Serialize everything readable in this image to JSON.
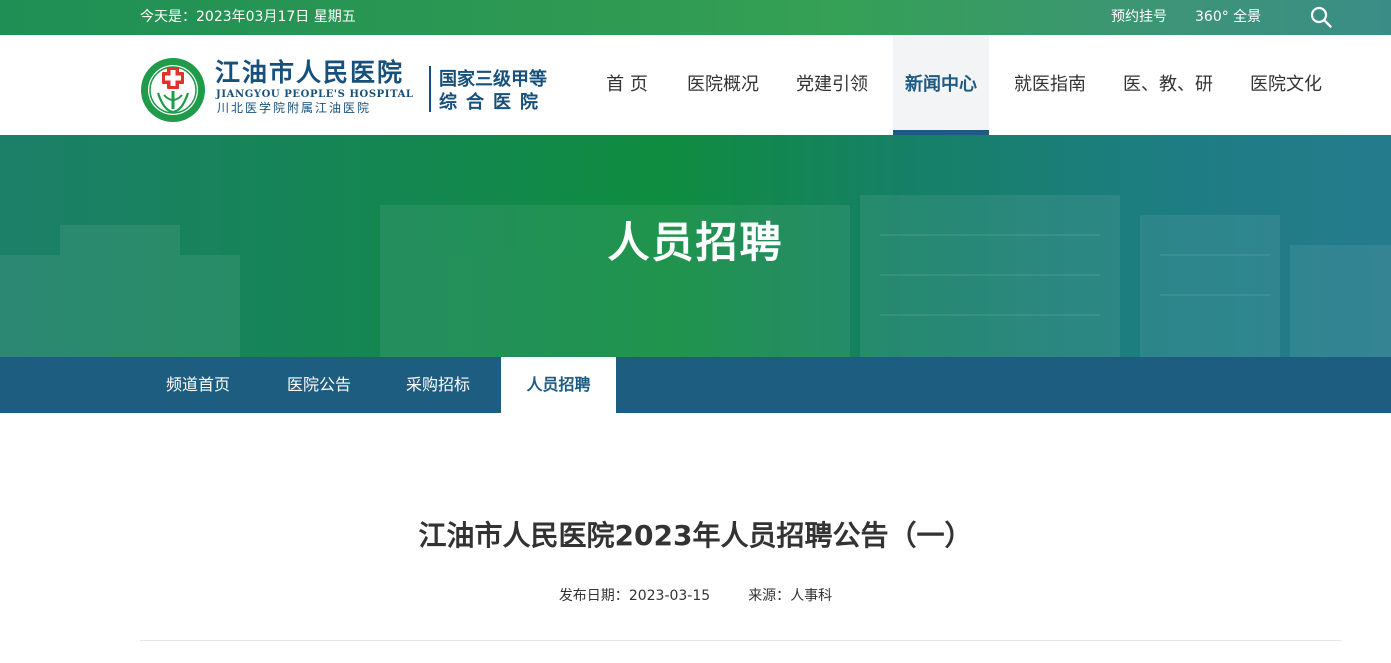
{
  "topbar": {
    "date_text": "今天是：2023年03月17日 星期五",
    "appointment_label": "预约挂号",
    "panorama_label": "360° 全景",
    "search_icon": "search-icon"
  },
  "logo": {
    "cn_name": "江油市人民医院",
    "en_name": "JIANGYOU PEOPLE'S HOSPITAL",
    "sub_name": "川北医学院附属江油医院",
    "grade_line1": "国家三级甲等",
    "grade_line2": "综合医院",
    "emblem_icon": "hospital-emblem-icon"
  },
  "nav": {
    "items": [
      {
        "label": "首  页"
      },
      {
        "label": "医院概况"
      },
      {
        "label": "党建引领"
      },
      {
        "label": "新闻中心",
        "active": true
      },
      {
        "label": "就医指南"
      },
      {
        "label": "医、教、研"
      },
      {
        "label": "医院文化"
      }
    ]
  },
  "banner": {
    "title": "人员招聘"
  },
  "subnav": {
    "items": [
      {
        "label": "频道首页"
      },
      {
        "label": "医院公告"
      },
      {
        "label": "采购招标"
      },
      {
        "label": "人员招聘",
        "active": true
      }
    ]
  },
  "article": {
    "title": "江油市人民医院2023年人员招聘公告（一）",
    "publish_label": "发布日期：",
    "publish_date": "2023-03-15",
    "source_label": "来源：",
    "source": "人事科"
  },
  "colors": {
    "brand_blue": "#1d5b82",
    "brand_green": "#0f8c3f",
    "subnav_bg": "#1d5d7f"
  }
}
